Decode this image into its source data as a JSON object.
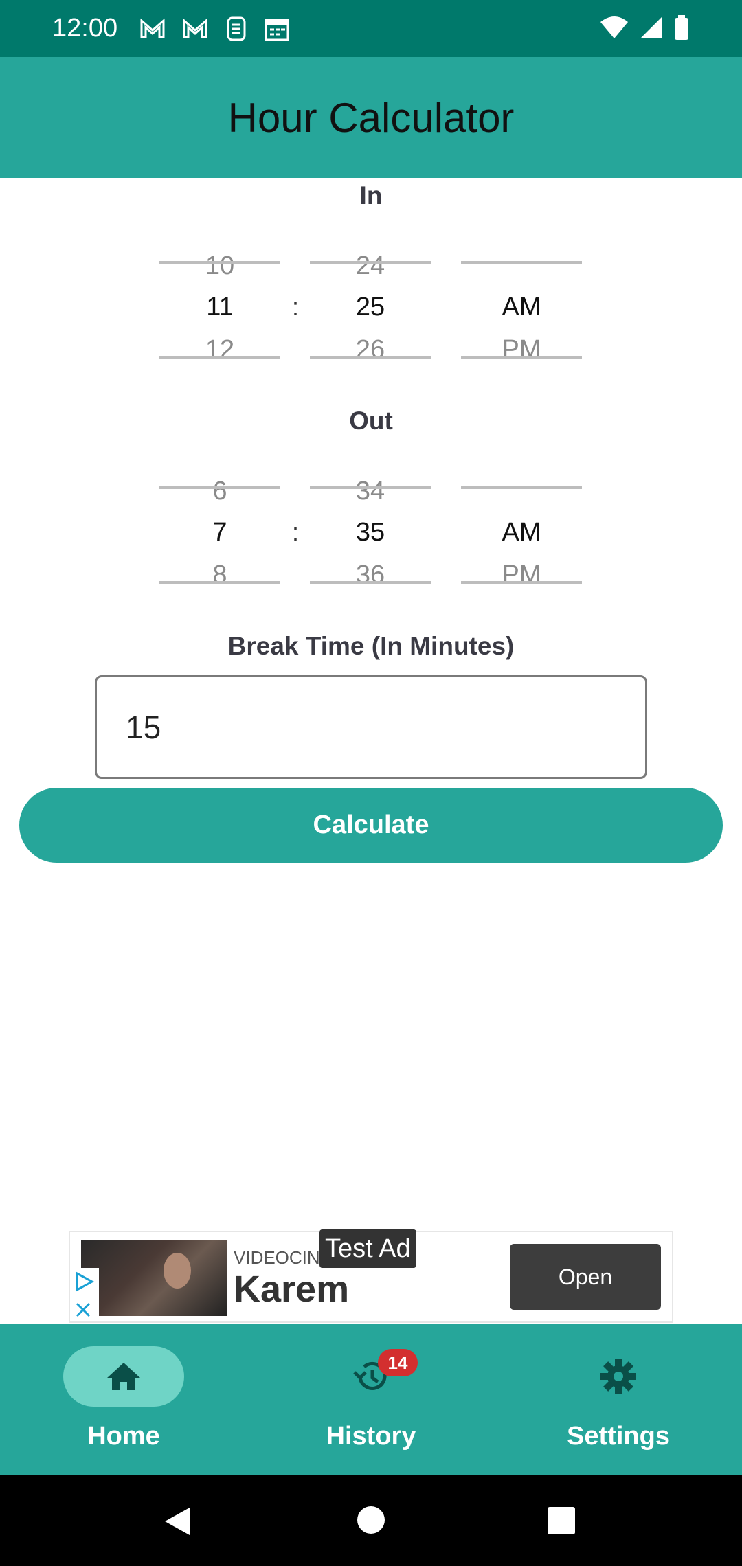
{
  "status_bar": {
    "time": "12:00"
  },
  "app_bar": {
    "title": "Hour Calculator"
  },
  "in_section": {
    "label": "In",
    "hour": {
      "prev": "10",
      "current": "11",
      "next": "12"
    },
    "separator": ":",
    "minute": {
      "prev": "24",
      "current": "25",
      "next": "26"
    },
    "ampm": {
      "prev": "",
      "current": "AM",
      "next": "PM"
    }
  },
  "out_section": {
    "label": "Out",
    "hour": {
      "prev": "6",
      "current": "7",
      "next": "8"
    },
    "separator": ":",
    "minute": {
      "prev": "34",
      "current": "35",
      "next": "36"
    },
    "ampm": {
      "prev": "",
      "current": "AM",
      "next": "PM"
    }
  },
  "break_time": {
    "label": "Break Time (In Minutes)",
    "value": "15"
  },
  "calculate_label": "Calculate",
  "ad": {
    "test_label": "Test Ad",
    "source": "VIDEOCINE",
    "headline": "Karem",
    "open_label": "Open"
  },
  "bottom_nav": {
    "items": [
      {
        "label": "Home",
        "icon": "home-icon",
        "selected": true
      },
      {
        "label": "History",
        "icon": "history-icon",
        "badge": "14"
      },
      {
        "label": "Settings",
        "icon": "gear-icon"
      }
    ]
  },
  "colors": {
    "status_bar": "#00796b",
    "primary": "#26a69a",
    "selected_pill": "#6fd4c6",
    "badge": "#d32f2f"
  }
}
